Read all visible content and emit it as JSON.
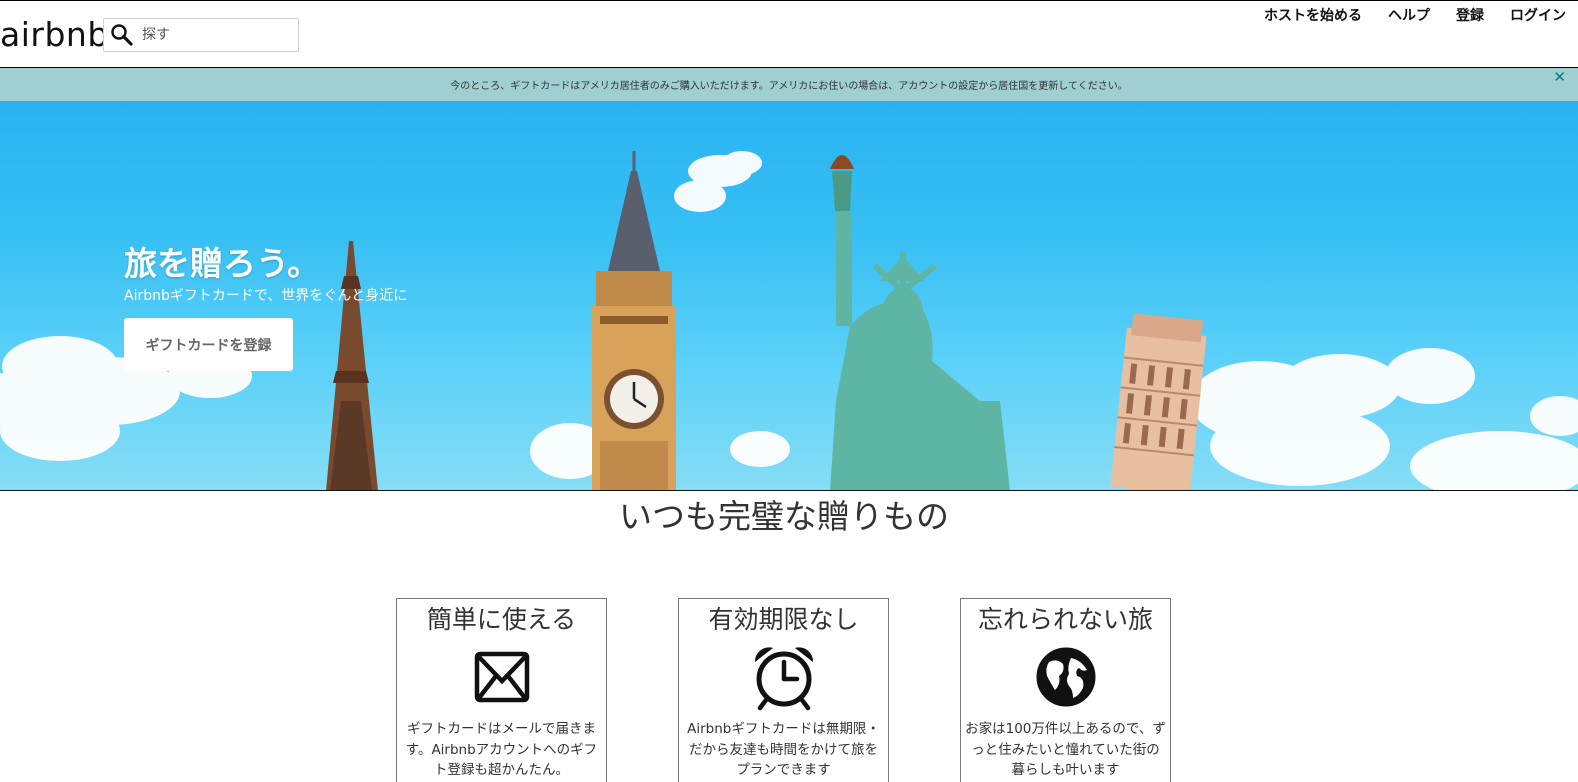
{
  "header": {
    "logo": "airbnb",
    "search_placeholder": "探す",
    "nav": [
      "ホストを始める",
      "ヘルプ",
      "登録",
      "ログイン"
    ]
  },
  "notice": {
    "message": "今のところ、ギフトカードはアメリカ居住者のみご購入いただけます。アメリカにお住いの場合は、アカウントの設定から居住国を更新してください。",
    "close_icon": "close-icon"
  },
  "hero": {
    "title": "旅を贈ろう。",
    "subtitle": "Airbnbギフトカードで、世界をぐんと身近に",
    "button": "ギフトカードを登録"
  },
  "main": {
    "title": "いつも完璧な贈りもの",
    "cards": [
      {
        "title": "簡単に使える",
        "icon": "envelope-icon",
        "text": "ギフトカードはメールで届きます。Airbnbアカウントへのギフト登録も超かんたん。"
      },
      {
        "title": "有効期限なし",
        "icon": "alarm-clock-icon",
        "text": "Airbnbギフトカードは無期限・だから友達も時間をかけて旅をプランできます"
      },
      {
        "title": "忘れられない旅",
        "icon": "globe-icon",
        "text": "お家は100万件以上あるので、ずっと住みたいと憧れていた街の暮らしも叶います"
      }
    ]
  },
  "colors": {
    "notice_bg": "#9fcfd0",
    "sky": "#2ab2f0",
    "close": "#0a7a86"
  }
}
